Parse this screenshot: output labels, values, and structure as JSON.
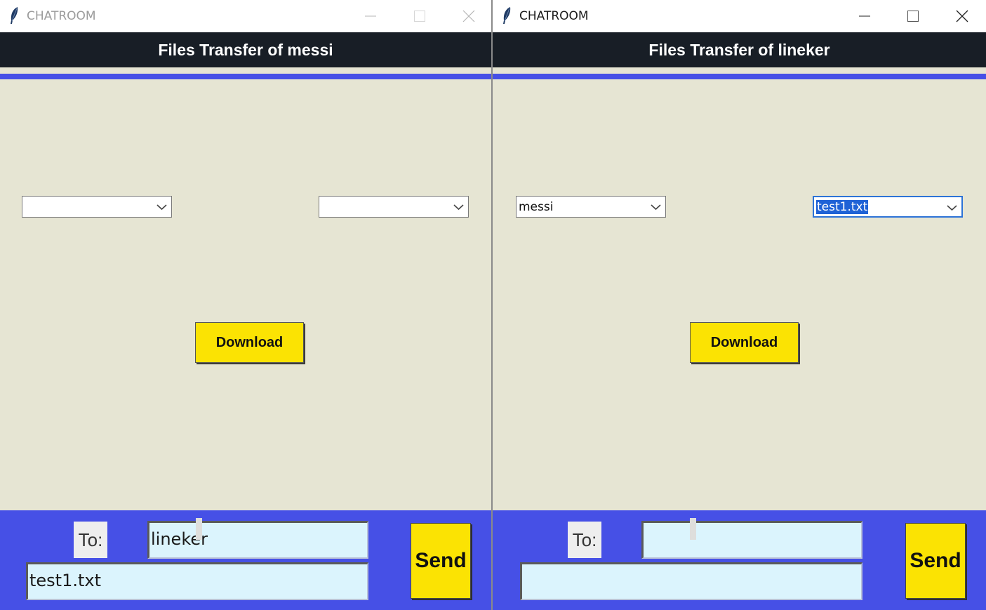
{
  "windows": [
    {
      "title": "CHATROOM",
      "header": "Files Transfer of messi",
      "user_combo_value": "",
      "file_combo_value": "",
      "download_label": "Download",
      "to_label": "To:",
      "to_value": "lineker",
      "message_value": "test1.txt",
      "send_label": "Send"
    },
    {
      "title": "CHATROOM",
      "header": "Files Transfer of lineker",
      "user_combo_value": "messi",
      "file_combo_value": "test1.txt",
      "download_label": "Download",
      "to_label": "To:",
      "to_value": "",
      "message_value": "",
      "send_label": "Send"
    }
  ],
  "icons": {
    "app": "feather-icon",
    "minimize": "minimize-icon",
    "maximize": "maximize-icon",
    "close": "close-icon",
    "dropdown": "chevron-down-icon"
  },
  "colors": {
    "header_bg": "#181e26",
    "accent_blue": "#4650e6",
    "button_yellow": "#fbe303",
    "body_bg": "#e6e5d3",
    "field_bg": "#dbf4fd",
    "selection": "#1f62d6"
  }
}
